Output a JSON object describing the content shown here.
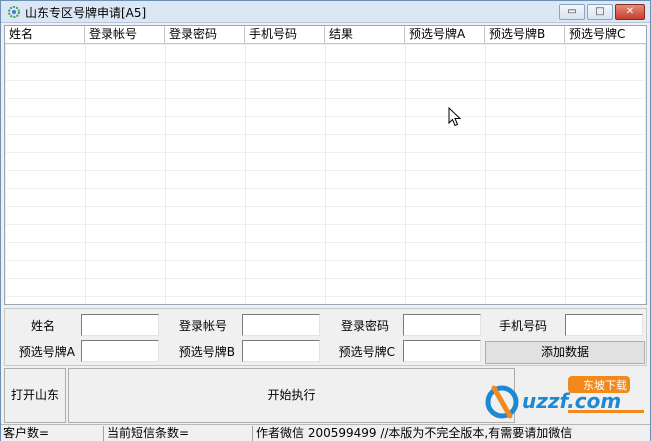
{
  "window": {
    "title": "山东专区号牌申请[A5]",
    "icon": "app-gear-icon",
    "controls": {
      "minimize": "▭",
      "maximize": "□",
      "close": "✕"
    }
  },
  "grid": {
    "columns": [
      "姓名",
      "登录帐号",
      "登录密码",
      "手机号码",
      "结果",
      "预选号牌A",
      "预选号牌B",
      "预选号牌C"
    ],
    "rows": []
  },
  "form": {
    "name_label": "姓名",
    "name_value": "",
    "account_label": "登录帐号",
    "account_value": "",
    "password_label": "登录密码",
    "password_value": "",
    "phone_label": "手机号码",
    "phone_value": "",
    "plate_a_label": "预选号牌A",
    "plate_a_value": "",
    "plate_b_label": "预选号牌B",
    "plate_b_value": "",
    "plate_c_label": "预选号牌C",
    "plate_c_value": "",
    "add_button": "添加数据"
  },
  "actions": {
    "open_label": "打开山东",
    "execute_label": "开始执行"
  },
  "watermark": {
    "text": "uzzf.com",
    "badge": "东坡下载"
  },
  "statusbar": {
    "customers": "客户数=",
    "sms_count": "当前短信条数=",
    "author_wechat": "作者微信  200599499  //本版为不完全版本,有需要请加微信"
  },
  "colors": {
    "titlebar": "#dbe7f5",
    "close_button": "#c4402f",
    "logo_blue": "#1e88d2",
    "logo_orange": "#f08a1c"
  }
}
